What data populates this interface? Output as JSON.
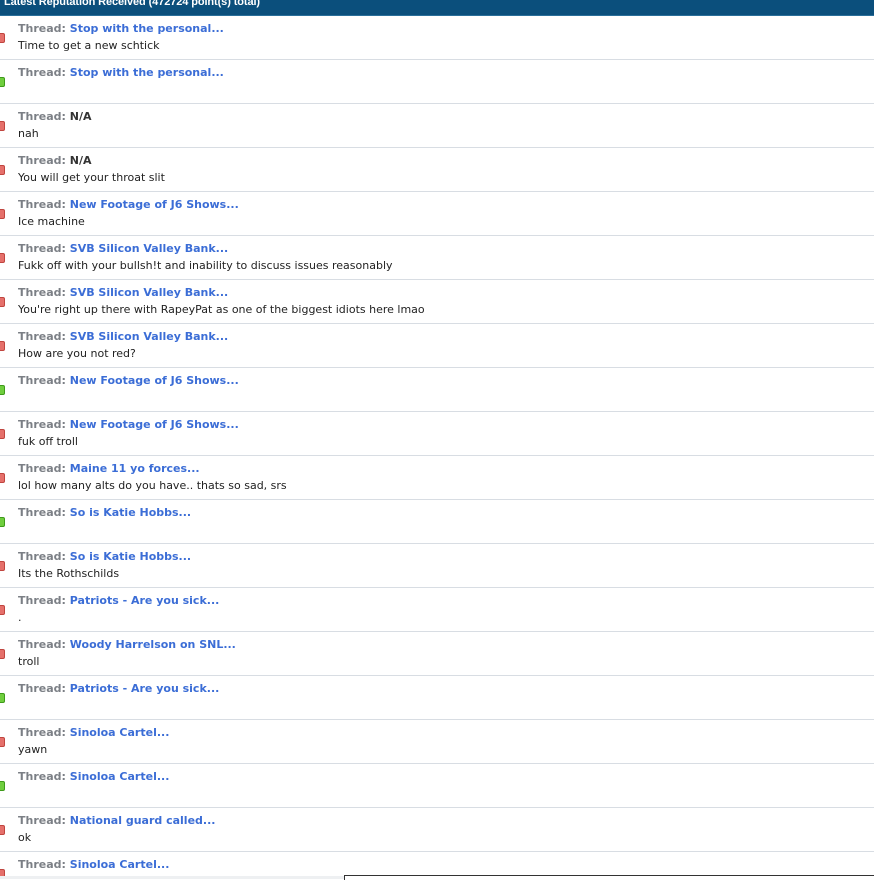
{
  "header": {
    "title": "Latest Reputation Received (472724 point(s) total)"
  },
  "thread_prefix": "Thread:",
  "items": [
    {
      "rep": "negative",
      "thread": "Stop with the personal...",
      "linked": true,
      "comment": "Time to get a new schtick"
    },
    {
      "rep": "positive",
      "thread": "Stop with the personal...",
      "linked": true,
      "comment": ""
    },
    {
      "rep": "negative",
      "thread": "N/A",
      "linked": false,
      "comment": "nah"
    },
    {
      "rep": "negative",
      "thread": "N/A",
      "linked": false,
      "comment": "You will get your throat slit"
    },
    {
      "rep": "negative",
      "thread": "New Footage of J6 Shows...",
      "linked": true,
      "comment": "Ice machine"
    },
    {
      "rep": "negative",
      "thread": "SVB Silicon Valley Bank...",
      "linked": true,
      "comment": "Fukk off with your bullsh!t and inability to discuss issues reasonably"
    },
    {
      "rep": "negative",
      "thread": "SVB Silicon Valley Bank...",
      "linked": true,
      "comment": "You're right up there with RapeyPat as one of the biggest idiots here lmao"
    },
    {
      "rep": "negative",
      "thread": "SVB Silicon Valley Bank...",
      "linked": true,
      "comment": "How are you not red?"
    },
    {
      "rep": "positive",
      "thread": "New Footage of J6 Shows...",
      "linked": true,
      "comment": ""
    },
    {
      "rep": "negative",
      "thread": "New Footage of J6 Shows...",
      "linked": true,
      "comment": "fuk off troll"
    },
    {
      "rep": "negative",
      "thread": "Maine 11 yo forces...",
      "linked": true,
      "comment": "lol how many alts do you have.. thats so sad, srs"
    },
    {
      "rep": "positive",
      "thread": "So is Katie Hobbs...",
      "linked": true,
      "comment": ""
    },
    {
      "rep": "negative",
      "thread": "So is Katie Hobbs...",
      "linked": true,
      "comment": "Its the Rothschilds"
    },
    {
      "rep": "negative",
      "thread": "Patriots - Are you sick...",
      "linked": true,
      "comment": "."
    },
    {
      "rep": "negative",
      "thread": "Woody Harrelson on SNL...",
      "linked": true,
      "comment": "troll"
    },
    {
      "rep": "positive",
      "thread": "Patriots - Are you sick...",
      "linked": true,
      "comment": ""
    },
    {
      "rep": "negative",
      "thread": "Sinoloa Cartel...",
      "linked": true,
      "comment": "yawn"
    },
    {
      "rep": "positive",
      "thread": "Sinoloa Cartel...",
      "linked": true,
      "comment": ""
    },
    {
      "rep": "negative",
      "thread": "National guard called...",
      "linked": true,
      "comment": "ok"
    },
    {
      "rep": "negative",
      "thread": "Sinoloa Cartel...",
      "linked": true,
      "comment": ""
    }
  ]
}
